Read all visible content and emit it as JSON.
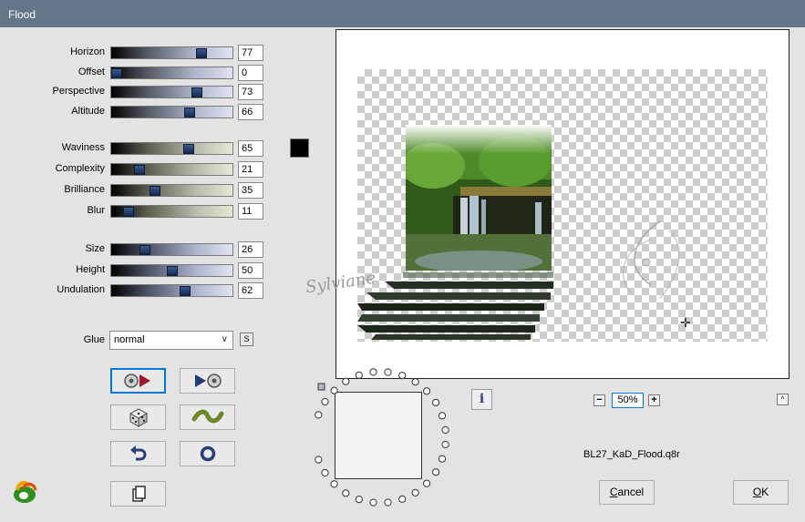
{
  "window": {
    "title": "Flood"
  },
  "sliders": {
    "horizon": {
      "label": "Horizon",
      "value": 77
    },
    "offset": {
      "label": "Offset",
      "value": 0
    },
    "perspective": {
      "label": "Perspective",
      "value": 73
    },
    "altitude": {
      "label": "Altitude",
      "value": 66
    },
    "waviness": {
      "label": "Waviness",
      "value": 65
    },
    "complexity": {
      "label": "Complexity",
      "value": 21
    },
    "brilliance": {
      "label": "Brilliance",
      "value": 35
    },
    "blur": {
      "label": "Blur",
      "value": 11
    },
    "size": {
      "label": "Size",
      "value": 26
    },
    "height": {
      "label": "Height",
      "value": 50
    },
    "undulation": {
      "label": "Undulation",
      "value": 62
    }
  },
  "color_swatch": {
    "color": "#000000"
  },
  "glue": {
    "label": "Glue",
    "value": "normal",
    "s_label": "S"
  },
  "tools": {
    "icons": [
      "save-preset-icon",
      "load-preset-icon",
      "random-dice-icon",
      "wave-reset-icon",
      "undo-icon",
      "default-reset-icon",
      "copy-icon"
    ]
  },
  "preview": {
    "watermark_text": "Sylviane"
  },
  "info": {
    "label": "i"
  },
  "zoom": {
    "value": "50%",
    "minus": "−",
    "plus": "+"
  },
  "nav": {
    "up_label": "^"
  },
  "preset": {
    "filename": "BL27_KaD_Flood.q8r"
  },
  "buttons": {
    "cancel_first": "C",
    "cancel_rest": "ancel",
    "ok_first": "O",
    "ok_rest": "K"
  },
  "colors": {
    "titlebar": "#66768a",
    "dialog_bg": "#e3e3e3",
    "thumb": "#1e3a6e",
    "selection": "#0078d7"
  }
}
